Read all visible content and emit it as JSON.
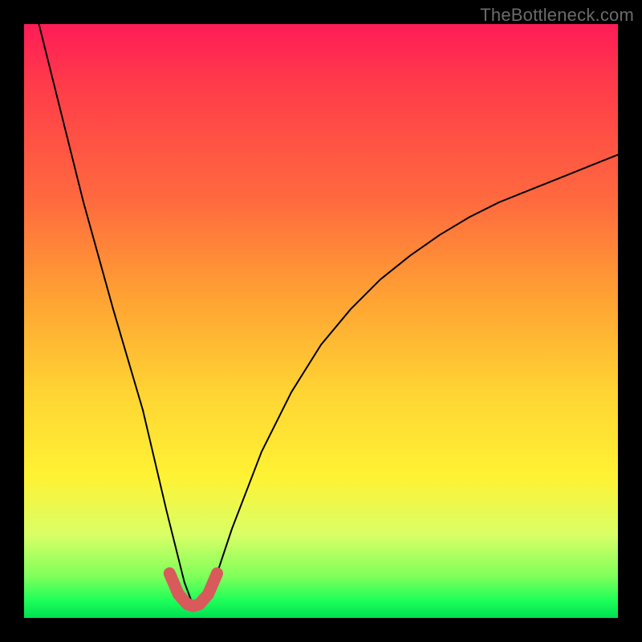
{
  "watermark": "TheBottleneck.com",
  "chart_data": {
    "type": "line",
    "title": "",
    "xlabel": "",
    "ylabel": "",
    "xlim": [
      0,
      1
    ],
    "ylim": [
      0,
      100
    ],
    "series": [
      {
        "name": "bottleneck-curve",
        "x": [
          0.0,
          0.05,
          0.1,
          0.15,
          0.2,
          0.24,
          0.27,
          0.285,
          0.3,
          0.32,
          0.35,
          0.4,
          0.45,
          0.5,
          0.55,
          0.6,
          0.65,
          0.7,
          0.75,
          0.8,
          0.85,
          0.9,
          0.95,
          1.0
        ],
        "values": [
          110,
          90,
          70,
          52,
          35,
          18,
          6,
          2,
          2,
          6,
          15,
          28,
          38,
          46,
          52,
          57,
          61,
          64.5,
          67.5,
          70,
          72,
          74,
          76,
          78
        ]
      },
      {
        "name": "bottom-highlight",
        "x": [
          0.245,
          0.26,
          0.275,
          0.285,
          0.295,
          0.31,
          0.325
        ],
        "values": [
          7.5,
          4.0,
          2.3,
          2.0,
          2.3,
          4.0,
          7.5
        ]
      }
    ],
    "colors": {
      "curve": "#000000",
      "highlight": "#d85a5a"
    },
    "gradient": {
      "stops": [
        {
          "pos": 0.0,
          "color": "#ff1c57"
        },
        {
          "pos": 0.3,
          "color": "#ff6b3e"
        },
        {
          "pos": 0.62,
          "color": "#ffd433"
        },
        {
          "pos": 0.86,
          "color": "#d9ff66"
        },
        {
          "pos": 1.0,
          "color": "#00e052"
        }
      ]
    }
  }
}
